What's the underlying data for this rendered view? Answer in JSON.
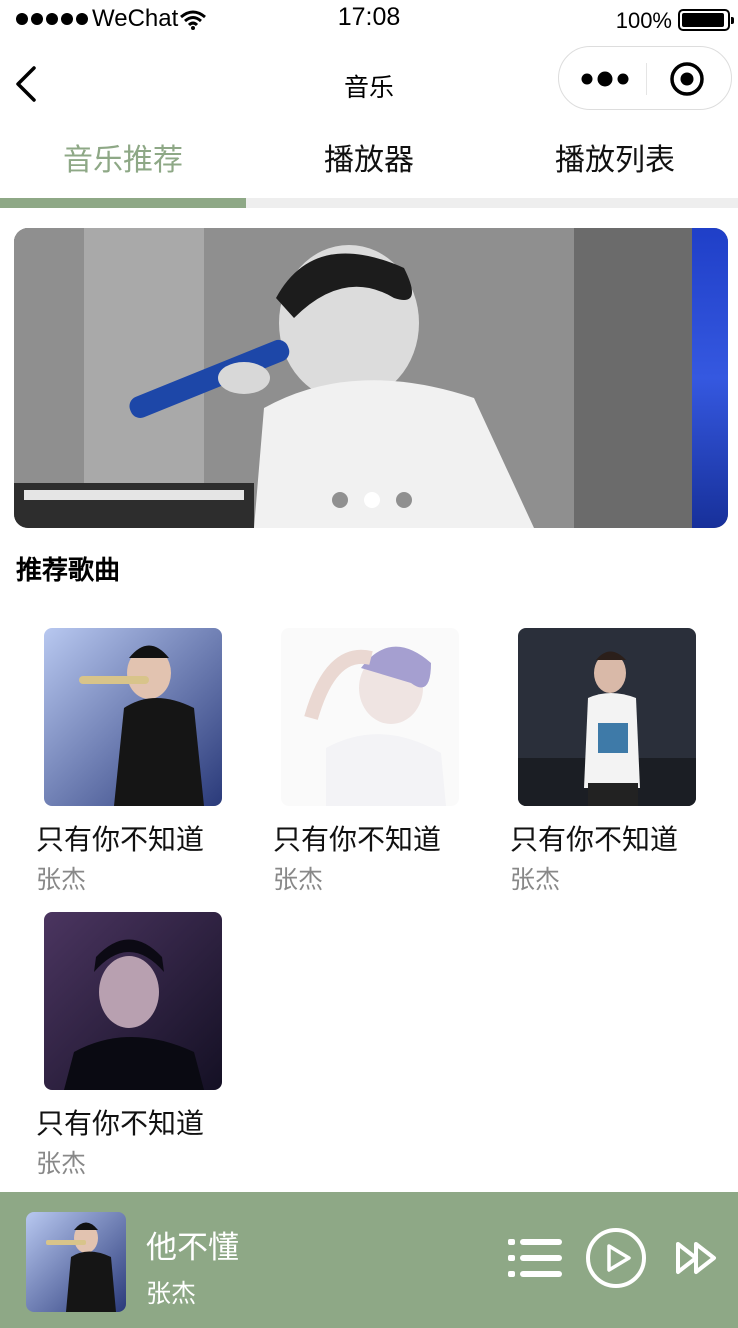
{
  "status_bar": {
    "carrier": "WeChat",
    "time": "17:08",
    "battery": "100%"
  },
  "nav": {
    "title": "音乐"
  },
  "tabs": [
    {
      "label": "音乐推荐",
      "active": true
    },
    {
      "label": "播放器",
      "active": false
    },
    {
      "label": "播放列表",
      "active": false
    }
  ],
  "banner": {
    "slide_count": 3,
    "active_slide": 2
  },
  "section": {
    "title": "推荐歌曲"
  },
  "songs": [
    {
      "title": "只有你不知道",
      "artist": "张杰"
    },
    {
      "title": "只有你不知道",
      "artist": "张杰"
    },
    {
      "title": "只有你不知道",
      "artist": "张杰"
    },
    {
      "title": "只有你不知道",
      "artist": "张杰"
    }
  ],
  "player": {
    "title": "他不懂",
    "artist": "张杰"
  },
  "colors": {
    "accent": "#8ea886",
    "tab_track": "#eeeeee",
    "artist_text": "#888888"
  },
  "icons": [
    "back-arrow-icon",
    "more-icon",
    "target-icon",
    "playlist-icon",
    "play-icon",
    "next-icon",
    "wifi-icon",
    "battery-icon"
  ]
}
